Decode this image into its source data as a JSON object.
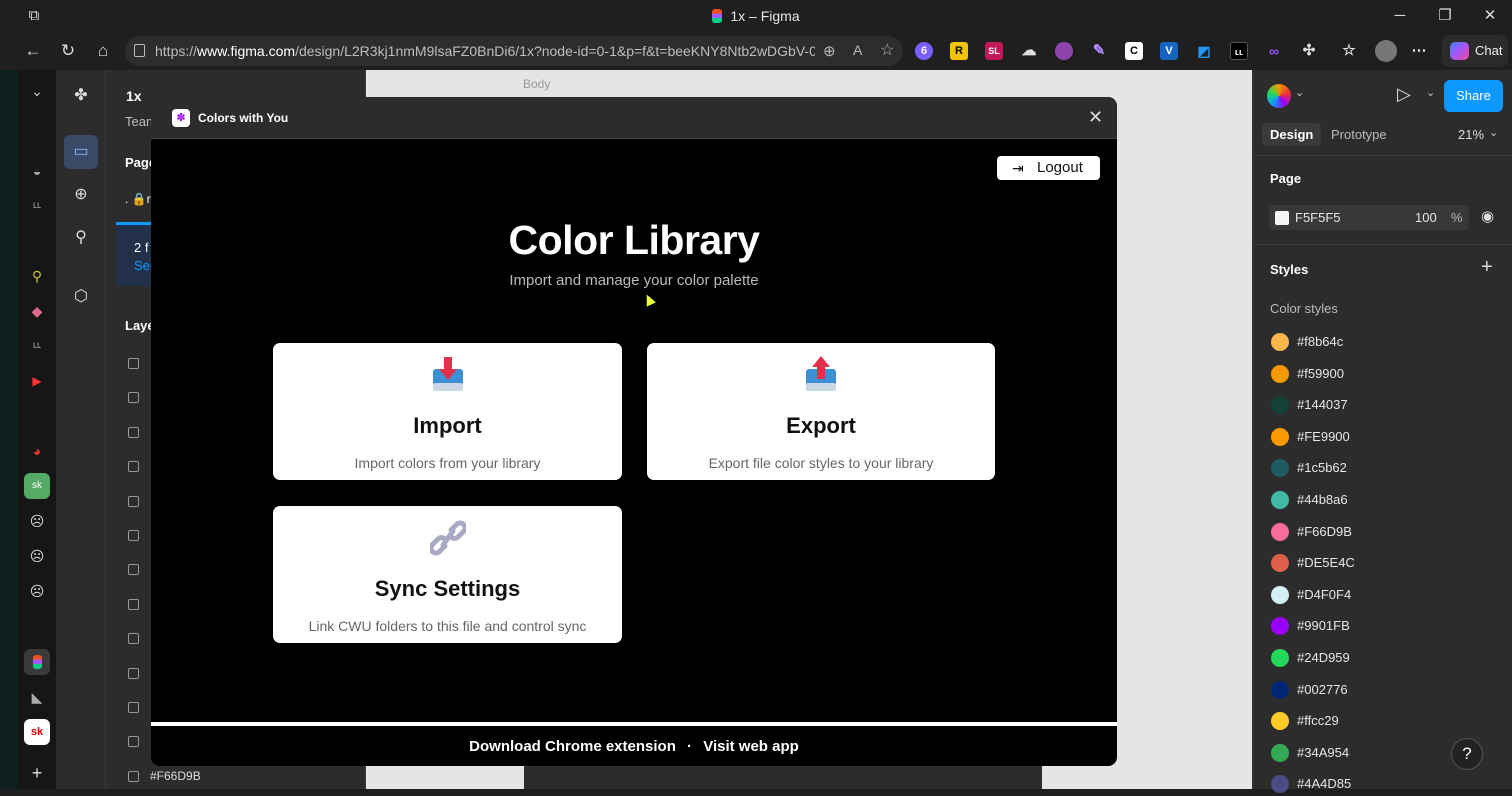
{
  "window": {
    "title": "1x – Figma"
  },
  "browser": {
    "url_prefix": "https://",
    "url_domain": "www.figma.com",
    "url_path": "/design/L2R3kj1nmM9lsaFZ0BnDi6/1x?node-id=0-1&p=f&t=beeKNY8Ntb2wDGbV-0",
    "ext_badge": "6",
    "ext_R": "R",
    "ext_SL": "SL",
    "ext_C": "C",
    "ext_V": "V",
    "chat_label": "Chat"
  },
  "figma": {
    "file_name": "1x",
    "team_label": "Team",
    "pages_label": "Page",
    "page_item": ". 🔒n",
    "notice_text": "2 f",
    "notice_link": "See",
    "layers_label": "Laye",
    "canvas_frame_label": "Body",
    "last_layer": "#F66D9B"
  },
  "plugin": {
    "name": "Colors with You",
    "logout_label": "Logout",
    "heading": "Color Library",
    "subheading": "Import and manage your color palette",
    "cards": [
      {
        "title": "Import",
        "desc": "Import colors from your library"
      },
      {
        "title": "Export",
        "desc": "Export file color styles to your library"
      },
      {
        "title": "Sync Settings",
        "desc": "Link CWU folders to this file and control sync"
      }
    ],
    "footer_link1": "Download Chrome extension",
    "footer_sep": "·",
    "footer_link2": "Visit web app"
  },
  "right_panel": {
    "tabs": [
      "Design",
      "Prototype"
    ],
    "zoom": "21%",
    "share_label": "Share",
    "page_section": "Page",
    "page_color": "F5F5F5",
    "page_opacity": "100",
    "percent_sign": "%",
    "styles_label": "Styles",
    "color_styles_label": "Color styles",
    "colors": [
      {
        "label": "#f8b64c",
        "hex": "#f8b64c"
      },
      {
        "label": "#f59900",
        "hex": "#f59900"
      },
      {
        "label": "#144037",
        "hex": "#144037"
      },
      {
        "label": "#FE9900",
        "hex": "#FE9900"
      },
      {
        "label": "#1c5b62",
        "hex": "#1c5b62"
      },
      {
        "label": "#44b8a6",
        "hex": "#44b8a6"
      },
      {
        "label": "#F66D9B",
        "hex": "#F66D9B"
      },
      {
        "label": "#DE5E4C",
        "hex": "#DE5E4C"
      },
      {
        "label": "#D4F0F4",
        "hex": "#D4F0F4"
      },
      {
        "label": "#9901FB",
        "hex": "#9901FB"
      },
      {
        "label": "#24D959",
        "hex": "#24D959"
      },
      {
        "label": "#002776",
        "hex": "#002776"
      },
      {
        "label": "#ffcc29",
        "hex": "#ffcc29"
      },
      {
        "label": "#34A954",
        "hex": "#34A954"
      },
      {
        "label": "#4A4D85",
        "hex": "#4A4D85"
      }
    ],
    "help": "?"
  },
  "colors": {
    "accent": "#0d99ff",
    "panel": "#2c2c2c",
    "plugin_bg": "#000000"
  }
}
